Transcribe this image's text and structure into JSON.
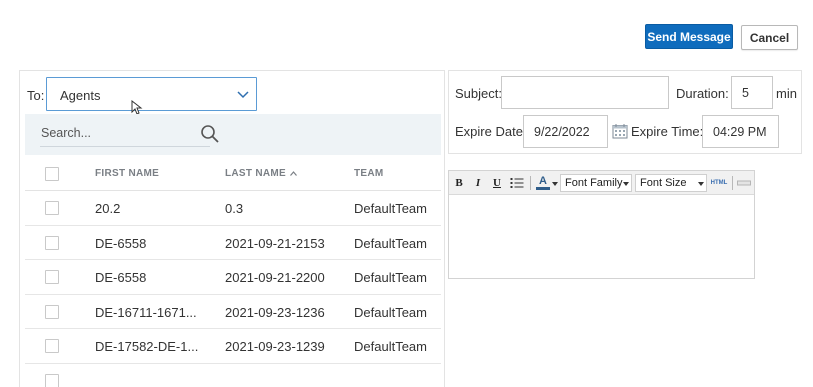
{
  "actions": {
    "send_label": "Send Message",
    "cancel_label": "Cancel"
  },
  "recipients": {
    "to_label": "To:",
    "to_value": "Agents",
    "search_placeholder": "Search..."
  },
  "table": {
    "columns": [
      "FIRST NAME",
      "LAST NAME",
      "TEAM"
    ],
    "sort_column": "LAST NAME",
    "sort_direction": "ascending",
    "rows": [
      {
        "first": "20.2",
        "last": "0.3",
        "team": "DefaultTeam"
      },
      {
        "first": "DE-6558",
        "last": "2021-09-21-2153",
        "team": "DefaultTeam"
      },
      {
        "first": "DE-6558",
        "last": "2021-09-21-2200",
        "team": "DefaultTeam"
      },
      {
        "first": "DE-16711-1671...",
        "last": "2021-09-23-1236",
        "team": "DefaultTeam"
      },
      {
        "first": "DE-17582-DE-1...",
        "last": "2021-09-23-1239",
        "team": "DefaultTeam"
      }
    ]
  },
  "message": {
    "subject_label": "Subject:",
    "subject_value": "",
    "duration_label": "Duration:",
    "duration_value": "5",
    "duration_unit": "min",
    "expire_date_label": "Expire Date:",
    "expire_date_value": "9/22/2022",
    "expire_time_label": "Expire Time:",
    "expire_time_value": "04:29 PM"
  },
  "editor": {
    "bold": "B",
    "italic": "I",
    "underline": "U",
    "font_color_letter": "A",
    "font_family": "Font Family",
    "font_size": "Font Size",
    "html_label": "HTML"
  },
  "colors": {
    "primary": "#0f6cbd",
    "focus_border": "#5b9bd5",
    "search_band": "#eef3f6"
  }
}
